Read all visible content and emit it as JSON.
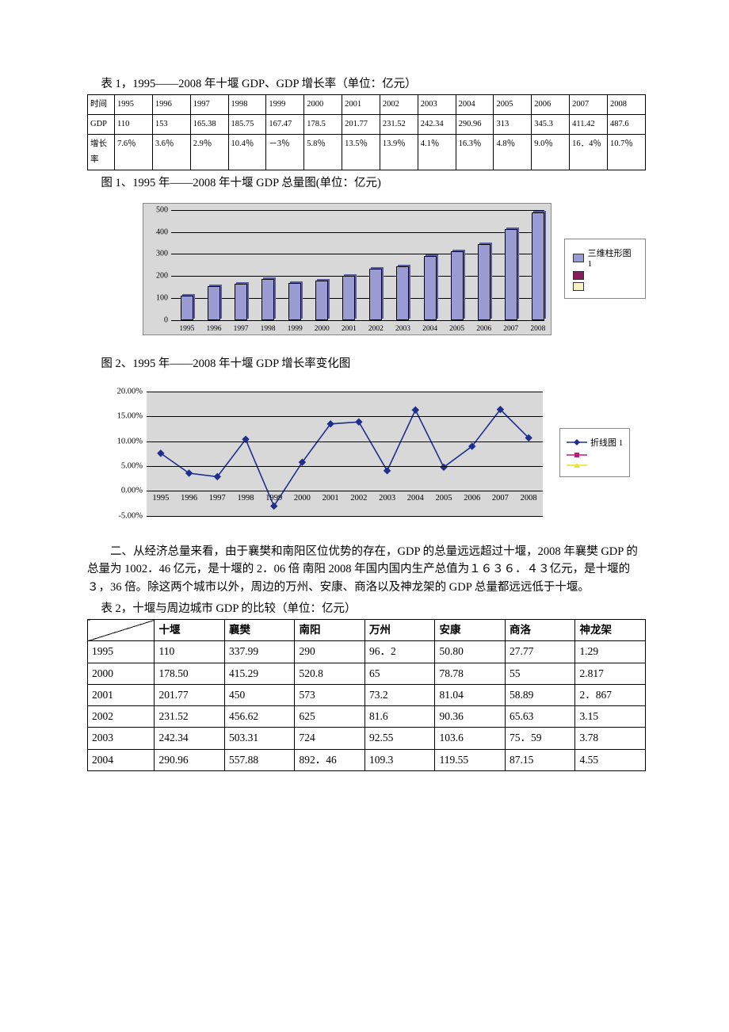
{
  "table1": {
    "title": "表 1，1995——2008 年十堰 GDP、GDP 增长率（单位：亿元）",
    "row_labels": {
      "time": "时间",
      "gdp": "GDP",
      "growth": "增长率"
    },
    "years": [
      "1995",
      "1996",
      "1997",
      "1998",
      "1999",
      "2000",
      "2001",
      "2002",
      "2003",
      "2004",
      "2005",
      "2006",
      "2007",
      "2008"
    ],
    "gdp": [
      "110",
      "153",
      "165.38",
      "185.75",
      "167.47",
      "178.5",
      "201.77",
      "231.52",
      "242.34",
      "290.96",
      "313",
      "345.3",
      "411.42",
      "487.6"
    ],
    "growth": [
      "7.6％",
      "3.6％",
      "2.9％",
      "10.4％",
      "－3％",
      "5.8％",
      "13.5％",
      "13.9％",
      "4.1％",
      "16.3％",
      "4.8％",
      "9.0％",
      "16．4％",
      "10.7％"
    ]
  },
  "chart1": {
    "caption": "图 1、1995 年——2008 年十堰 GDP 总量图(单位：亿元)",
    "legend": {
      "s1": "三维柱形图 1",
      "s2": "",
      "s3": ""
    }
  },
  "chart2": {
    "caption": "图 2、1995 年——2008 年十堰 GDP 增长率变化图",
    "legend": {
      "s1": "折线图 1",
      "s2": "",
      "s3": ""
    }
  },
  "paragraph": "二、从经济总量来看，由于襄樊和南阳区位优势的存在，GDP 的总量远远超过十堰，2008 年襄樊 GDP 的总量为 1002．46 亿元，是十堰的 2．06 倍  南阳 2008 年国内国内生产总值为１６３６．４３亿元，是十堰的３，36 倍。除这两个城市以外，周边的万州、安康、商洛以及神龙架的 GDP 总量都远远低于十堰。",
  "table2": {
    "title": "表 2，十堰与周边城市 GDP 的比较（单位：亿元）",
    "cities": [
      "十堰",
      "襄樊",
      "南阳",
      "万州",
      "安康",
      "商洛",
      "神龙架"
    ],
    "rows": {
      "1995": [
        "110",
        "337.99",
        "290",
        "96．2",
        "50.80",
        "27.77",
        "1.29"
      ],
      "2000": [
        "178.50",
        "415.29",
        "520.8",
        "65",
        "78.78",
        "55",
        "2.817"
      ],
      "2001": [
        "201.77",
        "450",
        "573",
        "73.2",
        "81.04",
        "58.89",
        "2．867"
      ],
      "2002": [
        "231.52",
        "456.62",
        "625",
        "81.6",
        "90.36",
        "65.63",
        "3.15"
      ],
      "2003": [
        "242.34",
        "503.31",
        "724",
        "92.55",
        "103.6",
        "75．59",
        "3.78"
      ],
      "2004": [
        "290.96",
        "557.88",
        "892．46",
        "109.3",
        "119.55",
        "87.15",
        "4.55"
      ]
    }
  },
  "chart_data": [
    {
      "type": "bar",
      "title": "1995年——2008年十堰 GDP 总量图 (亿元)",
      "categories": [
        "1995",
        "1996",
        "1997",
        "1998",
        "1999",
        "2000",
        "2001",
        "2002",
        "2003",
        "2004",
        "2005",
        "2006",
        "2007",
        "2008"
      ],
      "values": [
        110,
        153,
        165.38,
        185.75,
        167.47,
        178.5,
        201.77,
        231.52,
        242.34,
        290.96,
        313,
        345.3,
        411.42,
        487.6
      ],
      "xlabel": "",
      "ylabel": "",
      "ylim": [
        0,
        500
      ],
      "yticks": [
        0,
        100,
        200,
        300,
        400,
        500
      ],
      "series_name": "三维柱形图 1"
    },
    {
      "type": "line",
      "title": "1995年——2008年十堰 GDP 增长率变化图",
      "categories": [
        "1995",
        "1996",
        "1997",
        "1998",
        "1999",
        "2000",
        "2001",
        "2002",
        "2003",
        "2004",
        "2005",
        "2006",
        "2007",
        "2008"
      ],
      "values_percent": [
        7.6,
        3.6,
        2.9,
        10.4,
        -3.0,
        5.8,
        13.5,
        13.9,
        4.1,
        16.3,
        4.8,
        9.0,
        16.4,
        10.7
      ],
      "xlabel": "",
      "ylabel": "",
      "ylim_percent": [
        -5,
        20
      ],
      "yticks_percent": [
        -5,
        0,
        5,
        10,
        15,
        20
      ],
      "series_name": "折线图 1"
    }
  ]
}
